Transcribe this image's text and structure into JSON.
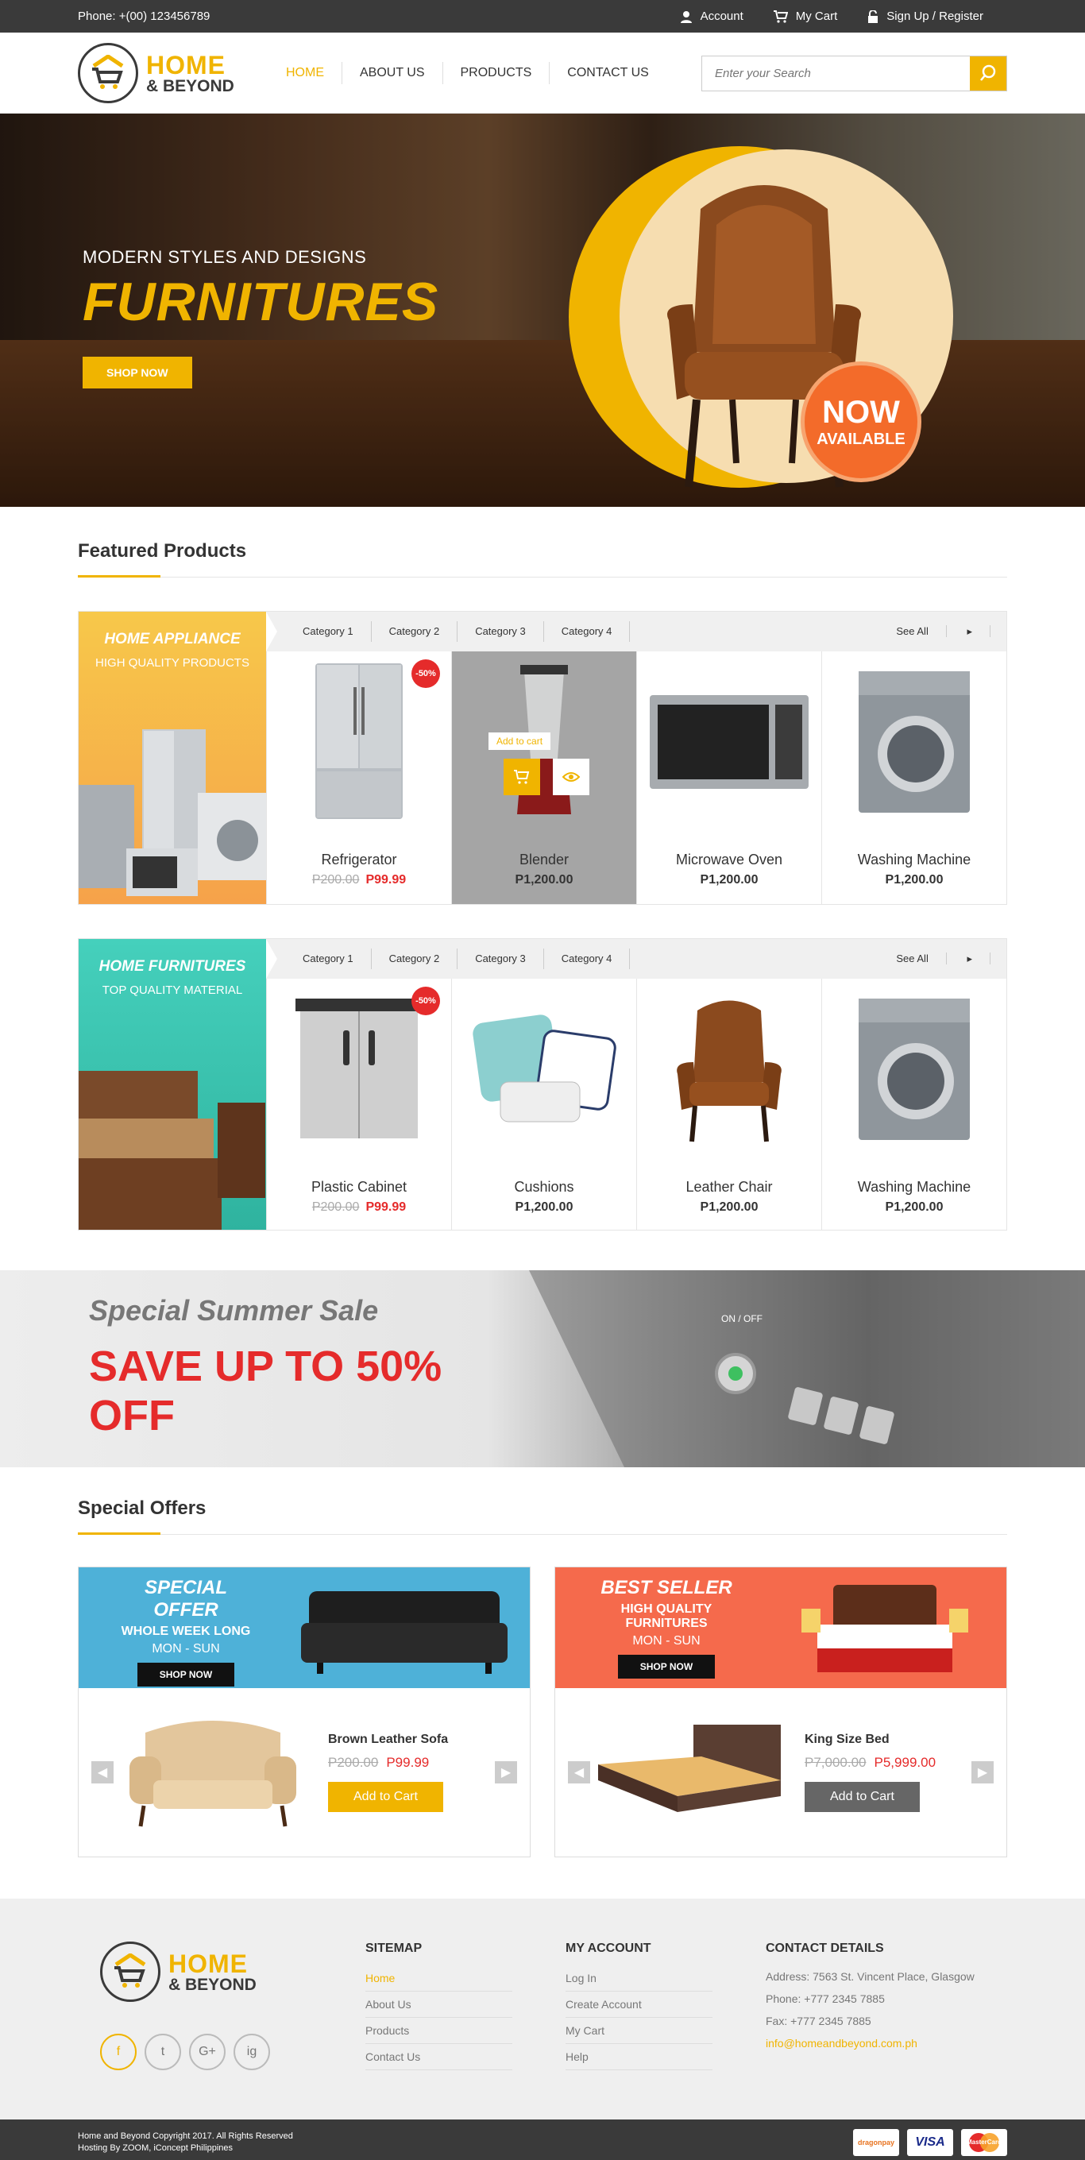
{
  "topbar": {
    "phone": "Phone: +(00) 123456789",
    "account": "Account",
    "cart": "My Cart",
    "signup": "Sign Up / Register"
  },
  "logo": {
    "line1": "HOME",
    "line2": "& BEYOND"
  },
  "nav": {
    "home": "HOME",
    "about": "ABOUT US",
    "products": "PRODUCTS",
    "contact": "CONTACT US"
  },
  "search": {
    "placeholder": "Enter your Search"
  },
  "hero": {
    "subtitle": "MODERN STYLES AND DESIGNS",
    "title": "FURNITURES",
    "button": "SHOP NOW",
    "badge_line1": "NOW",
    "badge_line2": "AVAILABLE"
  },
  "featured": {
    "title": "Featured Products"
  },
  "row1": {
    "banner_title": "HOME APPLIANCE",
    "banner_sub": "HIGH QUALITY PRODUCTS",
    "categories": [
      "Category 1",
      "Category 2",
      "Category 3",
      "Category 4"
    ],
    "see_all": "See All",
    "items": [
      {
        "name": "Refrigerator",
        "old": "P200.00",
        "price": "P99.99",
        "badge": "-50%"
      },
      {
        "name": "Blender",
        "price": "P1,200.00",
        "add_to_cart": "Add to cart"
      },
      {
        "name": "Microwave Oven",
        "price": "P1,200.00"
      },
      {
        "name": "Washing Machine",
        "price": "P1,200.00"
      }
    ]
  },
  "row2": {
    "banner_title": "HOME FURNITURES",
    "banner_sub": "TOP QUALITY MATERIAL",
    "categories": [
      "Category 1",
      "Category 2",
      "Category 3",
      "Category 4"
    ],
    "see_all": "See All",
    "items": [
      {
        "name": "Plastic Cabinet",
        "old": "P200.00",
        "price": "P99.99",
        "badge": "-50%"
      },
      {
        "name": "Cushions",
        "price": "P1,200.00"
      },
      {
        "name": "Leather Chair",
        "price": "P1,200.00"
      },
      {
        "name": "Washing Machine",
        "price": "P1,200.00"
      }
    ]
  },
  "sale": {
    "subtitle": "Special Summer Sale",
    "line1": "SAVE UP TO 50%",
    "line2": "OFF",
    "onoff": "ON / OFF"
  },
  "offers": {
    "title": "Special Offers",
    "left": {
      "banner_title": "SPECIAL OFFER",
      "banner_l2": "WHOLE WEEK LONG",
      "banner_l3": "MON - SUN",
      "banner_btn": "SHOP NOW",
      "product": "Brown Leather Sofa",
      "old": "P200.00",
      "price": "P99.99",
      "cart": "Add to Cart"
    },
    "right": {
      "banner_title": "BEST SELLER",
      "banner_l2": "HIGH QUALITY FURNITURES",
      "banner_l3": "MON - SUN",
      "banner_btn": "SHOP NOW",
      "product": "King Size Bed",
      "old": "P7,000.00",
      "price": "P5,999.00",
      "cart": "Add to Cart"
    }
  },
  "footer": {
    "sitemap": {
      "title": "SITEMAP",
      "links": [
        "Home",
        "About Us",
        "Products",
        "Contact Us"
      ]
    },
    "account": {
      "title": "MY ACCOUNT",
      "links": [
        "Log In",
        "Create Account",
        "My Cart",
        "Help"
      ]
    },
    "contact": {
      "title": "CONTACT DETAILS",
      "address": "Address: 7563 St. Vincent Place, Glasgow",
      "phone": "Phone: +777 2345 7885",
      "fax": "Fax: +777 2345 7885",
      "email": "info@homeandbeyond.com.ph"
    },
    "social": [
      "f",
      "t",
      "G+",
      "ig"
    ],
    "copyright": "Home and Beyond Copyright 2017. All Rights Reserved",
    "hosting": "Hosting By ZOOM, iConcept Philippines",
    "cards": [
      "dragonpay",
      "VISA",
      "MasterCard"
    ]
  },
  "colors": {
    "accent": "#f0b400",
    "sale": "#e52b2b",
    "dark": "#3a3a3a"
  }
}
